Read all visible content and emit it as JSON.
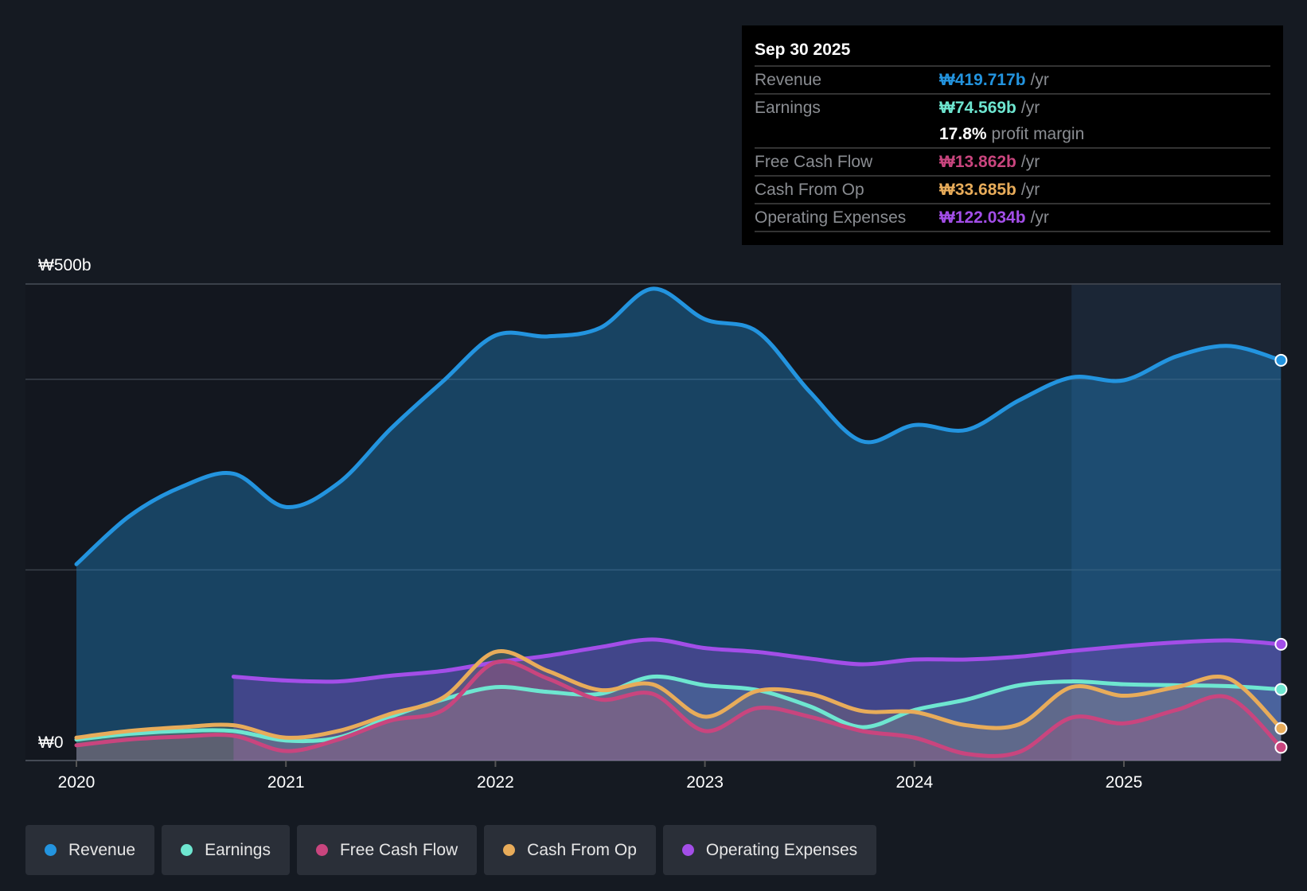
{
  "tooltip": {
    "date": "Sep 30 2025",
    "rows": [
      {
        "label": "Revenue",
        "value": "₩419.717b",
        "unit": "/yr",
        "color": "#2394df"
      },
      {
        "label": "Earnings",
        "value": "₩74.569b",
        "unit": "/yr",
        "color": "#6ee6d0"
      },
      {
        "label": "",
        "value": "17.8%",
        "unit": "profit margin",
        "color": "#ffffff"
      },
      {
        "label": "Free Cash Flow",
        "value": "₩13.862b",
        "unit": "/yr",
        "color": "#c9457e"
      },
      {
        "label": "Cash From Op",
        "value": "₩33.685b",
        "unit": "/yr",
        "color": "#e8ac5a"
      },
      {
        "label": "Operating Expenses",
        "value": "₩122.034b",
        "unit": "/yr",
        "color": "#a34ee8"
      }
    ]
  },
  "legend": [
    {
      "label": "Revenue",
      "color": "#2394df"
    },
    {
      "label": "Earnings",
      "color": "#6ee6d0"
    },
    {
      "label": "Free Cash Flow",
      "color": "#c9457e"
    },
    {
      "label": "Cash From Op",
      "color": "#e8ac5a"
    },
    {
      "label": "Operating Expenses",
      "color": "#a34ee8"
    }
  ],
  "chart_data": {
    "type": "area",
    "title": "",
    "xlabel": "",
    "ylabel": "",
    "ylim": [
      0,
      500
    ],
    "xlim": [
      2020,
      2025.75
    ],
    "y_tick_labels": [
      "₩500b",
      "₩0"
    ],
    "x_tick_labels": [
      "2020",
      "2021",
      "2022",
      "2023",
      "2024",
      "2025"
    ],
    "x_ticks": [
      2020,
      2021,
      2022,
      2023,
      2024,
      2025
    ],
    "gridlines": [
      0,
      200,
      400,
      500
    ],
    "highlight_from": 2024.75,
    "x": [
      2020,
      2020.25,
      2020.5,
      2020.75,
      2021,
      2021.25,
      2021.5,
      2021.75,
      2022,
      2022.25,
      2022.5,
      2022.75,
      2023,
      2023.25,
      2023.5,
      2023.75,
      2024,
      2024.25,
      2024.5,
      2024.75,
      2025,
      2025.25,
      2025.5,
      2025.75
    ],
    "series": [
      {
        "name": "Revenue",
        "color": "#2394df",
        "values": [
          206,
          256,
          287,
          301,
          266,
          291,
          348,
          398,
          446,
          445,
          454,
          495,
          463,
          450,
          387,
          335,
          352,
          347,
          378,
          402,
          399,
          424,
          435,
          420
        ]
      },
      {
        "name": "Operating Expenses",
        "color": "#a34ee8",
        "values": [
          null,
          null,
          null,
          88,
          84,
          83,
          89,
          94,
          103,
          110,
          119,
          127,
          118,
          114,
          107,
          101,
          106,
          106,
          109,
          115,
          120,
          124,
          126,
          122
        ]
      },
      {
        "name": "Earnings",
        "color": "#6ee6d0",
        "values": [
          22,
          28,
          31,
          31,
          21,
          24,
          46,
          64,
          77,
          72,
          70,
          88,
          79,
          74,
          57,
          35,
          53,
          64,
          79,
          83,
          80,
          79,
          78,
          74.6
        ]
      },
      {
        "name": "Cash From Op",
        "color": "#e8ac5a",
        "values": [
          24,
          31,
          35,
          37,
          24,
          31,
          49,
          66,
          114,
          94,
          74,
          80,
          46,
          73,
          70,
          52,
          51,
          37,
          38,
          77,
          68,
          77,
          86,
          33.7
        ]
      },
      {
        "name": "Free Cash Flow",
        "color": "#c9457e",
        "values": [
          16,
          22,
          25,
          26,
          10,
          22,
          42,
          53,
          103,
          86,
          64,
          70,
          31,
          55,
          46,
          31,
          24,
          7,
          9,
          45,
          39,
          53,
          66,
          13.9
        ]
      }
    ]
  }
}
